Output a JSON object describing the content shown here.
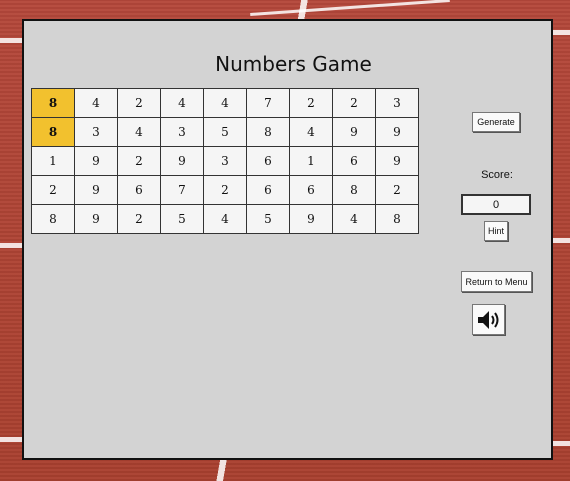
{
  "title": "Numbers Game",
  "grid": {
    "rows": [
      [
        8,
        4,
        2,
        4,
        4,
        7,
        2,
        2,
        3
      ],
      [
        8,
        3,
        4,
        3,
        5,
        8,
        4,
        9,
        9
      ],
      [
        1,
        9,
        2,
        9,
        3,
        6,
        1,
        6,
        9
      ],
      [
        2,
        9,
        6,
        7,
        2,
        6,
        6,
        8,
        2
      ],
      [
        8,
        9,
        2,
        5,
        4,
        5,
        9,
        4,
        8
      ]
    ],
    "selected": [
      [
        0,
        0
      ],
      [
        1,
        0
      ]
    ],
    "selected_color": "#f2c12e"
  },
  "controls": {
    "generate_label": "Generate",
    "score_label": "Score:",
    "score_value": "0",
    "hint_label": "Hint",
    "menu_label": "Return to Menu"
  },
  "icons": {
    "sound": "speaker-volume-icon"
  },
  "colors": {
    "panel": "#d3d3d3",
    "track": "#b4483a"
  }
}
